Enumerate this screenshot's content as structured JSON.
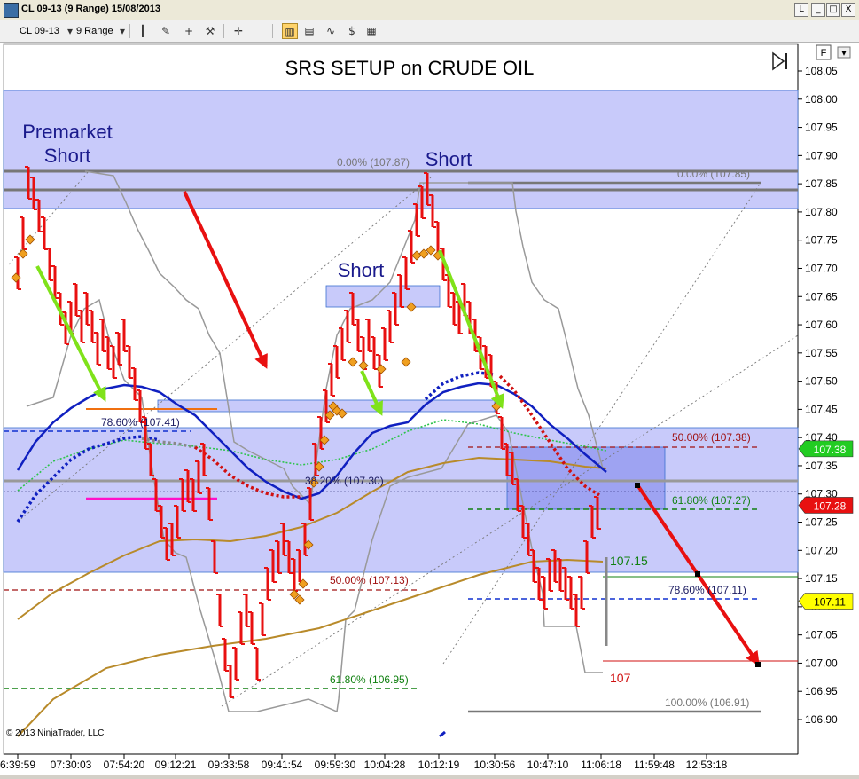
{
  "window": {
    "title": "CL 09-13 (9 Range)  15/08/2013",
    "buttons": [
      "L",
      "_",
      "□",
      "X"
    ]
  },
  "toolbar": {
    "instrument": "CL 09-13",
    "period": "9 Range"
  },
  "chart_data": {
    "type": "bar",
    "title": "SRS SETUP on CRUDE OIL",
    "watermark": "© 2013 NinjaTrader, LLC",
    "x_ticks": [
      "6:39:59",
      "07:30:03",
      "07:54:20",
      "09:12:21",
      "09:33:58",
      "09:41:54",
      "09:59:30",
      "10:04:28",
      "10:12:19",
      "10:30:56",
      "10:47:10",
      "11:06:18",
      "11:59:48",
      "12:53:18"
    ],
    "ylim": [
      106.88,
      108.08
    ],
    "y_ticks": [
      108.05,
      108.0,
      107.95,
      107.9,
      107.85,
      107.8,
      107.75,
      107.7,
      107.65,
      107.6,
      107.55,
      107.5,
      107.45,
      107.4,
      107.35,
      107.3,
      107.25,
      107.2,
      107.15,
      107.1,
      107.05,
      107.0,
      106.95,
      106.9
    ],
    "price_markers": [
      {
        "label": "107.38",
        "value": 107.38,
        "color": "#22cc22"
      },
      {
        "label": "107.28",
        "value": 107.28,
        "color": "#e81010"
      },
      {
        "label": "107.11",
        "value": 107.11,
        "color": "#ffff00"
      }
    ],
    "annotations": [
      {
        "text": "Premarket",
        "color": "#1a1a8c"
      },
      {
        "text": "Short",
        "color": "#1a1a8c"
      },
      {
        "text": "Short",
        "color": "#1a1a8c"
      },
      {
        "text": "Short",
        "color": "#1a1a8c"
      }
    ],
    "fib_labels": {
      "left": [
        "0.00% (107.87)",
        "78.60% (107.41)",
        "38.20% (107.30)",
        "50.00% (107.13)",
        "61.80% (106.95)"
      ],
      "right": [
        "0.00% (107.85)",
        "50.00% (107.38)",
        "61.80% (107.27)",
        "78.60% (107.11)",
        "100.00% (106.91)"
      ]
    },
    "price_labels": [
      "107.15",
      "107"
    ],
    "flag": "F"
  }
}
